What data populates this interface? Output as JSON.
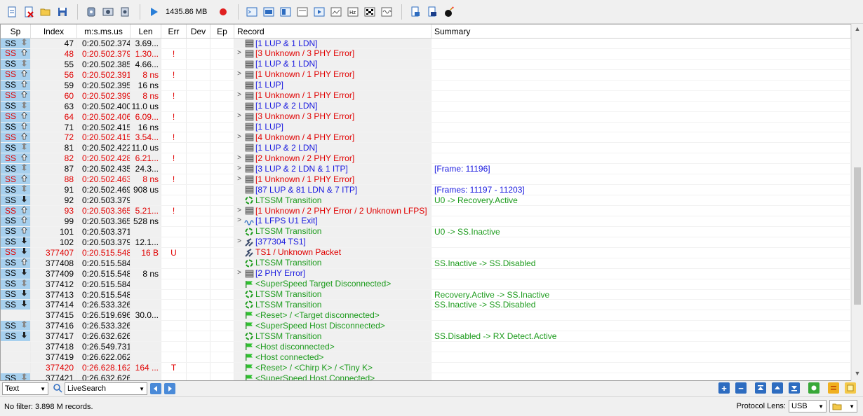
{
  "toolbar": {
    "memory": "1435.86 MB",
    "buttons": [
      "new-file-icon",
      "close-file-icon",
      "open-folder-icon",
      "save-icon",
      "device-icon",
      "settings-icon",
      "device-settings-icon",
      "play-icon",
      "record-icon",
      "view-1-icon",
      "view-2-icon",
      "view-3-icon",
      "view-4-icon",
      "view-5-icon",
      "view-6-icon",
      "view-hz-icon",
      "view-grid-icon",
      "view-wave-icon",
      "export-icon",
      "export-2-icon",
      "bomb-icon"
    ]
  },
  "columns": {
    "sp": "Sp",
    "index": "Index",
    "time": "m:s.ms.us",
    "len": "Len",
    "err": "Err",
    "dev": "Dev",
    "ep": "Ep",
    "record": "Record",
    "summary": "Summary"
  },
  "colors": {
    "red": "#e00000",
    "blue": "#1a1adf",
    "green": "#1c9b1c",
    "sp_bg": "#a7d0ee"
  },
  "rows": [
    {
      "sp": "SS",
      "arrow": "both",
      "idx": "47",
      "time": "0:20.502.374",
      "len": "3.69...",
      "err": "",
      "exp": false,
      "icon": "stack",
      "rec": "[1 LUP & 1 LDN]",
      "rc": "blue",
      "sum": "",
      "sc": "",
      "red": false
    },
    {
      "sp": "SS",
      "arrow": "up",
      "idx": "48",
      "time": "0:20.502.379",
      "len": "1.30...",
      "err": "!",
      "exp": true,
      "icon": "stack",
      "rec": "[3 Unknown / 3 PHY Error]",
      "rc": "red",
      "sum": "",
      "sc": "",
      "red": true
    },
    {
      "sp": "SS",
      "arrow": "both",
      "idx": "55",
      "time": "0:20.502.385",
      "len": "4.66...",
      "err": "",
      "exp": false,
      "icon": "stack",
      "rec": "[1 LUP & 1 LDN]",
      "rc": "blue",
      "sum": "",
      "sc": "",
      "red": false
    },
    {
      "sp": "SS",
      "arrow": "up",
      "idx": "56",
      "time": "0:20.502.391",
      "len": "8 ns",
      "err": "!",
      "exp": true,
      "icon": "stack",
      "rec": "[1 Unknown / 1 PHY Error]",
      "rc": "red",
      "sum": "",
      "sc": "",
      "red": true
    },
    {
      "sp": "SS",
      "arrow": "up",
      "idx": "59",
      "time": "0:20.502.395",
      "len": "16 ns",
      "err": "",
      "exp": false,
      "icon": "stack",
      "rec": "[1 LUP]",
      "rc": "blue",
      "sum": "",
      "sc": "",
      "red": false
    },
    {
      "sp": "SS",
      "arrow": "up",
      "idx": "60",
      "time": "0:20.502.399",
      "len": "8 ns",
      "err": "!",
      "exp": true,
      "icon": "stack",
      "rec": "[1 Unknown / 1 PHY Error]",
      "rc": "red",
      "sum": "",
      "sc": "",
      "red": true
    },
    {
      "sp": "SS",
      "arrow": "both",
      "idx": "63",
      "time": "0:20.502.400",
      "len": "11.0 us",
      "err": "",
      "exp": false,
      "icon": "stack",
      "rec": "[1 LUP & 2 LDN]",
      "rc": "blue",
      "sum": "",
      "sc": "",
      "red": false
    },
    {
      "sp": "SS",
      "arrow": "up",
      "idx": "64",
      "time": "0:20.502.406",
      "len": "6.09...",
      "err": "!",
      "exp": true,
      "icon": "stack",
      "rec": "[3 Unknown / 3 PHY Error]",
      "rc": "red",
      "sum": "",
      "sc": "",
      "red": true
    },
    {
      "sp": "SS",
      "arrow": "up",
      "idx": "71",
      "time": "0:20.502.415",
      "len": "16 ns",
      "err": "",
      "exp": false,
      "icon": "stack",
      "rec": "[1 LUP]",
      "rc": "blue",
      "sum": "",
      "sc": "",
      "red": false
    },
    {
      "sp": "SS",
      "arrow": "up",
      "idx": "72",
      "time": "0:20.502.415",
      "len": "3.54...",
      "err": "!",
      "exp": true,
      "icon": "stack",
      "rec": "[4 Unknown / 4 PHY Error]",
      "rc": "red",
      "sum": "",
      "sc": "",
      "red": true
    },
    {
      "sp": "SS",
      "arrow": "both",
      "idx": "81",
      "time": "0:20.502.422",
      "len": "11.0 us",
      "err": "",
      "exp": false,
      "icon": "stack",
      "rec": "[1 LUP & 2 LDN]",
      "rc": "blue",
      "sum": "",
      "sc": "",
      "red": false
    },
    {
      "sp": "SS",
      "arrow": "up",
      "idx": "82",
      "time": "0:20.502.428",
      "len": "6.21...",
      "err": "!",
      "exp": true,
      "icon": "stack",
      "rec": "[2 Unknown / 2 PHY Error]",
      "rc": "red",
      "sum": "",
      "sc": "",
      "red": true
    },
    {
      "sp": "SS",
      "arrow": "both",
      "idx": "87",
      "time": "0:20.502.435",
      "len": "24.3...",
      "err": "",
      "exp": true,
      "icon": "stack",
      "rec": "[3 LUP & 2 LDN & 1 ITP]",
      "rc": "blue",
      "sum": "[Frame: 11196]",
      "sc": "blue",
      "red": false
    },
    {
      "sp": "SS",
      "arrow": "up",
      "idx": "88",
      "time": "0:20.502.463",
      "len": "8 ns",
      "err": "!",
      "exp": true,
      "icon": "stack",
      "rec": "[1 Unknown / 1 PHY Error]",
      "rc": "red",
      "sum": "",
      "sc": "",
      "red": true
    },
    {
      "sp": "SS",
      "arrow": "both",
      "idx": "91",
      "time": "0:20.502.469",
      "len": "908 us",
      "err": "",
      "exp": false,
      "icon": "stack",
      "rec": "[87 LUP & 81 LDN & 7 ITP]",
      "rc": "blue",
      "sum": "[Frames: 11197 - 11203]",
      "sc": "blue",
      "red": false
    },
    {
      "sp": "SS",
      "arrow": "down",
      "idx": "92",
      "time": "0:20.503.379",
      "len": "",
      "err": "",
      "exp": false,
      "icon": "ltssm",
      "rec": "LTSSM Transition",
      "rc": "green",
      "sum": "U0 -> Recovery.Active",
      "sc": "green",
      "red": false
    },
    {
      "sp": "SS",
      "arrow": "up",
      "idx": "93",
      "time": "0:20.503.365",
      "len": "5.21...",
      "err": "!",
      "exp": true,
      "icon": "stack",
      "rec": "[1 Unknown / 2 PHY Error / 2 Unknown LFPS]",
      "rc": "red",
      "sum": "",
      "sc": "",
      "red": true
    },
    {
      "sp": "SS",
      "arrow": "up",
      "idx": "99",
      "time": "0:20.503.365",
      "len": "528 ns",
      "err": "",
      "exp": true,
      "icon": "lfps",
      "rec": "[1 LFPS U1 Exit]",
      "rc": "blue",
      "sum": "",
      "sc": "",
      "red": false
    },
    {
      "sp": "SS",
      "arrow": "up",
      "idx": "101",
      "time": "0:20.503.371",
      "len": "",
      "err": "",
      "exp": false,
      "icon": "ltssm",
      "rec": "LTSSM Transition",
      "rc": "green",
      "sum": "U0 -> SS.Inactive",
      "sc": "green",
      "red": false
    },
    {
      "sp": "SS",
      "arrow": "down",
      "idx": "102",
      "time": "0:20.503.379",
      "len": "12.1...",
      "err": "",
      "exp": true,
      "icon": "ts",
      "rec": "[377304 TS1]",
      "rc": "blue",
      "sum": "",
      "sc": "",
      "red": false
    },
    {
      "sp": "SS",
      "arrow": "down",
      "idx": "377407",
      "time": "0:20.515.548",
      "len": "16 B",
      "err": "U",
      "exp": false,
      "icon": "ts",
      "rec": "TS1 / Unknown Packet",
      "rc": "red",
      "sum": "",
      "sc": "",
      "red": true
    },
    {
      "sp": "SS",
      "arrow": "up",
      "idx": "377408",
      "time": "0:20.515.584",
      "len": "",
      "err": "",
      "exp": false,
      "icon": "ltssm",
      "rec": "LTSSM Transition",
      "rc": "green",
      "sum": "SS.Inactive -> SS.Disabled",
      "sc": "green",
      "red": false
    },
    {
      "sp": "SS",
      "arrow": "down",
      "idx": "377409",
      "time": "0:20.515.548",
      "len": "8 ns",
      "err": "",
      "exp": true,
      "icon": "stack",
      "rec": "[2 PHY Error]",
      "rc": "blue",
      "sum": "",
      "sc": "",
      "red": false
    },
    {
      "sp": "SS",
      "arrow": "both",
      "idx": "377412",
      "time": "0:20.515.584",
      "len": "",
      "err": "",
      "exp": false,
      "icon": "flag",
      "rec": "<SuperSpeed Target Disconnected>",
      "rc": "green",
      "sum": "",
      "sc": "",
      "red": false
    },
    {
      "sp": "SS",
      "arrow": "down",
      "idx": "377413",
      "time": "0:20.515.548",
      "len": "",
      "err": "",
      "exp": false,
      "icon": "ltssm",
      "rec": "LTSSM Transition",
      "rc": "green",
      "sum": "Recovery.Active -> SS.Inactive",
      "sc": "green",
      "red": false
    },
    {
      "sp": "SS",
      "arrow": "down",
      "idx": "377414",
      "time": "0:26.533.326",
      "len": "",
      "err": "",
      "exp": false,
      "icon": "ltssm",
      "rec": "LTSSM Transition",
      "rc": "green",
      "sum": "SS.Inactive -> SS.Disabled",
      "sc": "green",
      "red": false
    },
    {
      "sp": "",
      "arrow": "",
      "idx": "377415",
      "time": "0:26.519.696",
      "len": "30.0...",
      "err": "",
      "exp": false,
      "icon": "flag",
      "rec": "<Reset> / <Target disconnected>",
      "rc": "green",
      "sum": "",
      "sc": "",
      "red": false
    },
    {
      "sp": "SS",
      "arrow": "both",
      "idx": "377416",
      "time": "0:26.533.326",
      "len": "",
      "err": "",
      "exp": false,
      "icon": "flag",
      "rec": "<SuperSpeed Host Disconnected>",
      "rc": "green",
      "sum": "",
      "sc": "",
      "red": false
    },
    {
      "sp": "SS",
      "arrow": "down",
      "idx": "377417",
      "time": "0:26.632.626",
      "len": "",
      "err": "",
      "exp": false,
      "icon": "ltssm",
      "rec": "LTSSM Transition",
      "rc": "green",
      "sum": "SS.Disabled -> RX Detect.Active",
      "sc": "green",
      "red": false
    },
    {
      "sp": "",
      "arrow": "",
      "idx": "377418",
      "time": "0:26.549.731",
      "len": "",
      "err": "",
      "exp": false,
      "icon": "flag",
      "rec": "<Host disconnected>",
      "rc": "green",
      "sum": "",
      "sc": "",
      "red": false
    },
    {
      "sp": "",
      "arrow": "",
      "idx": "377419",
      "time": "0:26.622.062",
      "len": "",
      "err": "",
      "exp": false,
      "icon": "flag",
      "rec": "<Host connected>",
      "rc": "green",
      "sum": "",
      "sc": "",
      "red": false
    },
    {
      "sp": "",
      "arrow": "",
      "idx": "377420",
      "time": "0:26.628.162",
      "len": "164 ...",
      "err": "T",
      "exp": false,
      "icon": "flag",
      "rec": "<Reset> / <Chirp K> / <Tiny K>",
      "rc": "green",
      "sum": "",
      "sc": "",
      "red": true
    },
    {
      "sp": "SS",
      "arrow": "both",
      "idx": "377421",
      "time": "0:26.632.626",
      "len": "",
      "err": "",
      "exp": false,
      "icon": "flag",
      "rec": "<SuperSpeed Host Connected>",
      "rc": "green",
      "sum": "",
      "sc": "",
      "red": false
    }
  ],
  "search": {
    "mode": "Text",
    "query": "LiveSearch"
  },
  "status": {
    "text": "No filter: 3.898 M records.",
    "lens_label": "Protocol Lens:",
    "lens_value": "USB"
  }
}
